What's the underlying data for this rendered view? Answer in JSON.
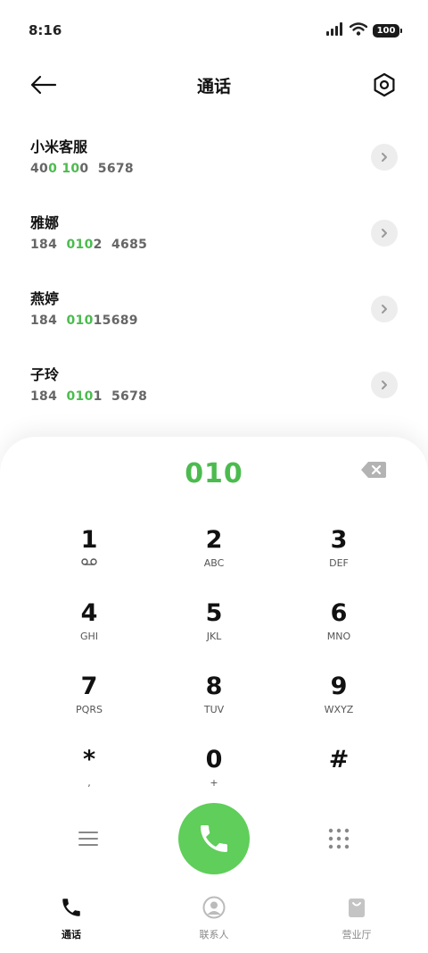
{
  "status_bar": {
    "time": "8:16",
    "battery": "100"
  },
  "header": {
    "title": "通话"
  },
  "contacts": [
    {
      "name": "小米客服",
      "number_parts": [
        {
          "t": "40",
          "h": false
        },
        {
          "t": "0",
          "h": true
        },
        {
          "t": " ",
          "h": false
        },
        {
          "t": "10",
          "h": true
        },
        {
          "t": "0  5678",
          "h": false
        }
      ]
    },
    {
      "name": "雅娜",
      "number_parts": [
        {
          "t": "184  ",
          "h": false
        },
        {
          "t": "010",
          "h": true
        },
        {
          "t": "2  4685",
          "h": false
        }
      ]
    },
    {
      "name": "燕婷",
      "number_parts": [
        {
          "t": "184  ",
          "h": false
        },
        {
          "t": "010",
          "h": true
        },
        {
          "t": "15689",
          "h": false
        }
      ]
    },
    {
      "name": "子玲",
      "number_parts": [
        {
          "t": "184  ",
          "h": false
        },
        {
          "t": "010",
          "h": true
        },
        {
          "t": "1  5678",
          "h": false
        }
      ]
    }
  ],
  "dialer": {
    "input": "010",
    "keys": [
      {
        "digit": "1",
        "letters": "voicemail",
        "voicemail": true
      },
      {
        "digit": "2",
        "letters": "ABC"
      },
      {
        "digit": "3",
        "letters": "DEF"
      },
      {
        "digit": "4",
        "letters": "GHI"
      },
      {
        "digit": "5",
        "letters": "JKL"
      },
      {
        "digit": "6",
        "letters": "MNO"
      },
      {
        "digit": "7",
        "letters": "PQRS"
      },
      {
        "digit": "8",
        "letters": "TUV"
      },
      {
        "digit": "9",
        "letters": "WXYZ"
      },
      {
        "digit": "*",
        "letters": ","
      },
      {
        "digit": "0",
        "letters": "+"
      },
      {
        "digit": "#",
        "letters": ""
      }
    ]
  },
  "tabs": [
    {
      "label": "通话",
      "icon": "phone-icon",
      "active": true
    },
    {
      "label": "联系人",
      "icon": "contacts-icon",
      "active": false
    },
    {
      "label": "营业厅",
      "icon": "shop-bag-icon",
      "active": false
    }
  ],
  "colors": {
    "accent": "#4cbb4f",
    "call_button": "#5fce5a"
  }
}
